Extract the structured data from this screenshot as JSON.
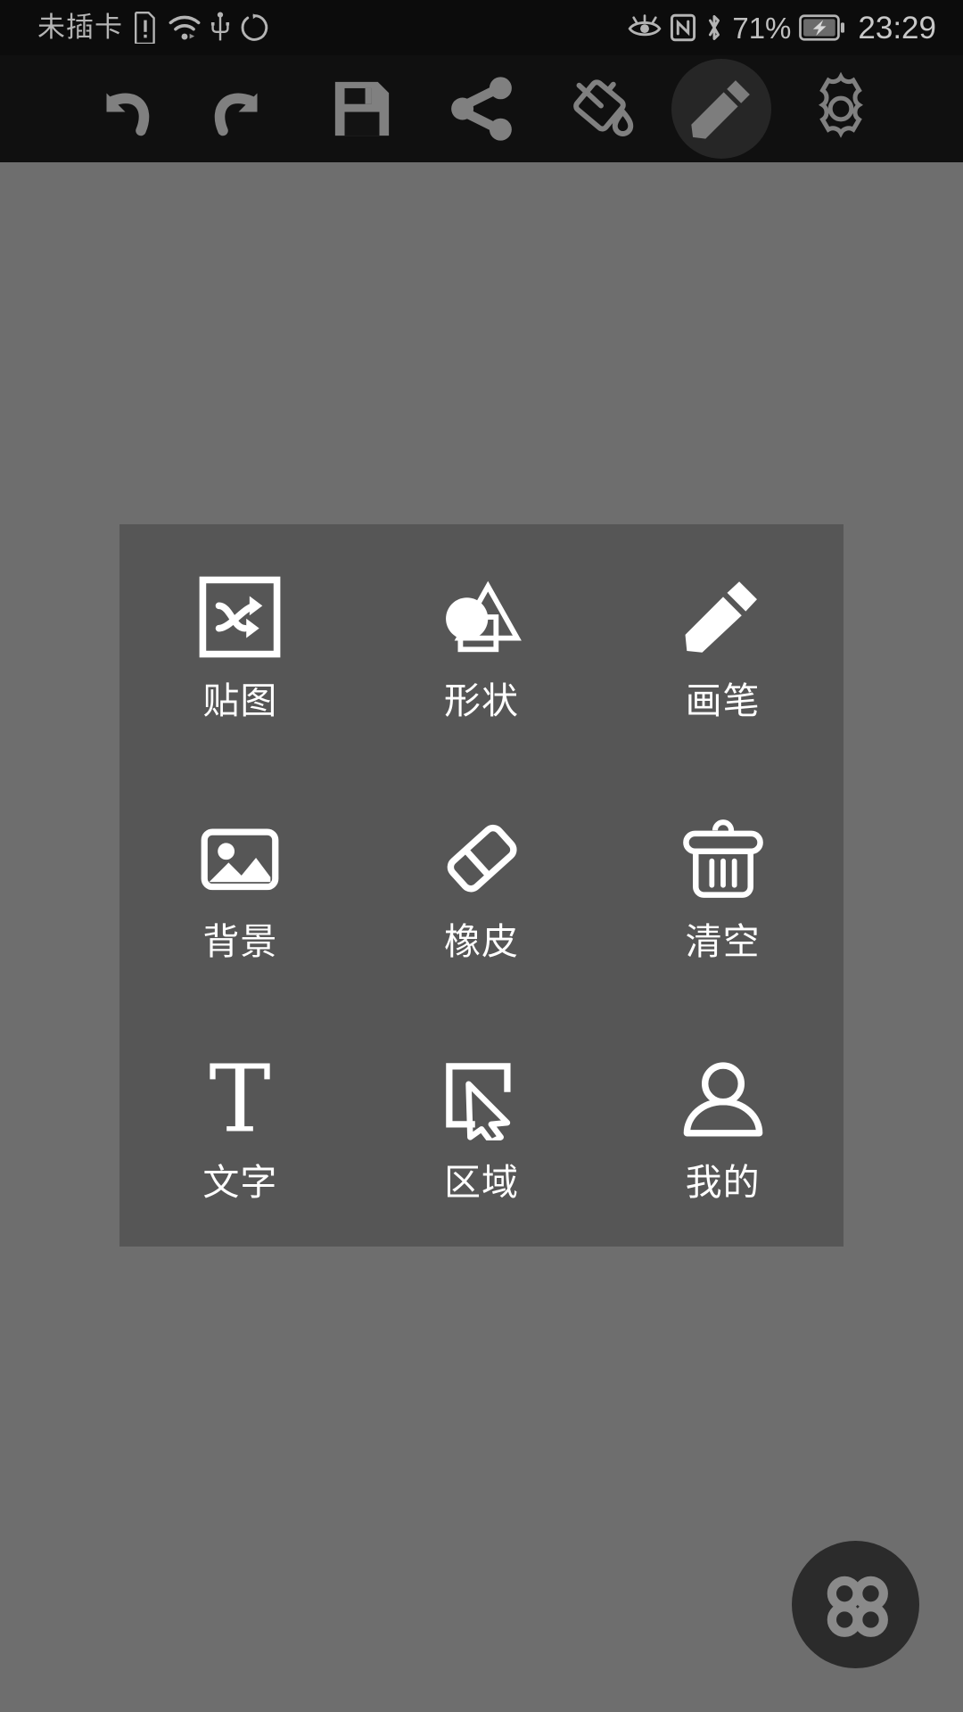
{
  "status_bar": {
    "carrier_text": "未插卡",
    "clock": "23:29",
    "battery_percent": "71%",
    "left_icons": [
      "sim-alert-icon",
      "wifi-icon",
      "usb-icon",
      "rotate-icon"
    ],
    "right_icons": [
      "eye-comfort-icon",
      "nfc-icon",
      "bluetooth-icon",
      "battery-charging-icon"
    ],
    "background_color": "#0c0c0c",
    "text_color": "#b4b4b4"
  },
  "toolbar": {
    "background_color": "#101010",
    "icon_color": "#7a7a7a",
    "active_background": "#262626",
    "buttons": [
      {
        "name": "undo",
        "icon": "undo-icon",
        "active": false
      },
      {
        "name": "redo",
        "icon": "redo-icon",
        "active": false
      },
      {
        "name": "save",
        "icon": "save-icon",
        "active": false
      },
      {
        "name": "share",
        "icon": "share-icon",
        "active": false
      },
      {
        "name": "fill",
        "icon": "paint-bucket-icon",
        "active": false
      },
      {
        "name": "pen",
        "icon": "pencil-icon",
        "active": true
      },
      {
        "name": "settings",
        "icon": "gear-icon",
        "active": false
      }
    ]
  },
  "canvas": {
    "background_color": "#6e6e6e"
  },
  "panel": {
    "background_color": "#565656",
    "items": [
      {
        "label": "贴图",
        "icon": "sticker-shuffle-icon"
      },
      {
        "label": "形状",
        "icon": "shapes-icon"
      },
      {
        "label": "画笔",
        "icon": "pencil-icon"
      },
      {
        "label": "背景",
        "icon": "image-icon"
      },
      {
        "label": "橡皮",
        "icon": "eraser-icon"
      },
      {
        "label": "清空",
        "icon": "trash-icon"
      },
      {
        "label": "文字",
        "icon": "text-t-icon"
      },
      {
        "label": "区域",
        "icon": "select-area-icon"
      },
      {
        "label": "我的",
        "icon": "person-icon"
      }
    ]
  },
  "floating_button": {
    "icon": "four-dots-icon",
    "background_color": "#2b2b2b",
    "dot_color": "#8a8a8a"
  }
}
